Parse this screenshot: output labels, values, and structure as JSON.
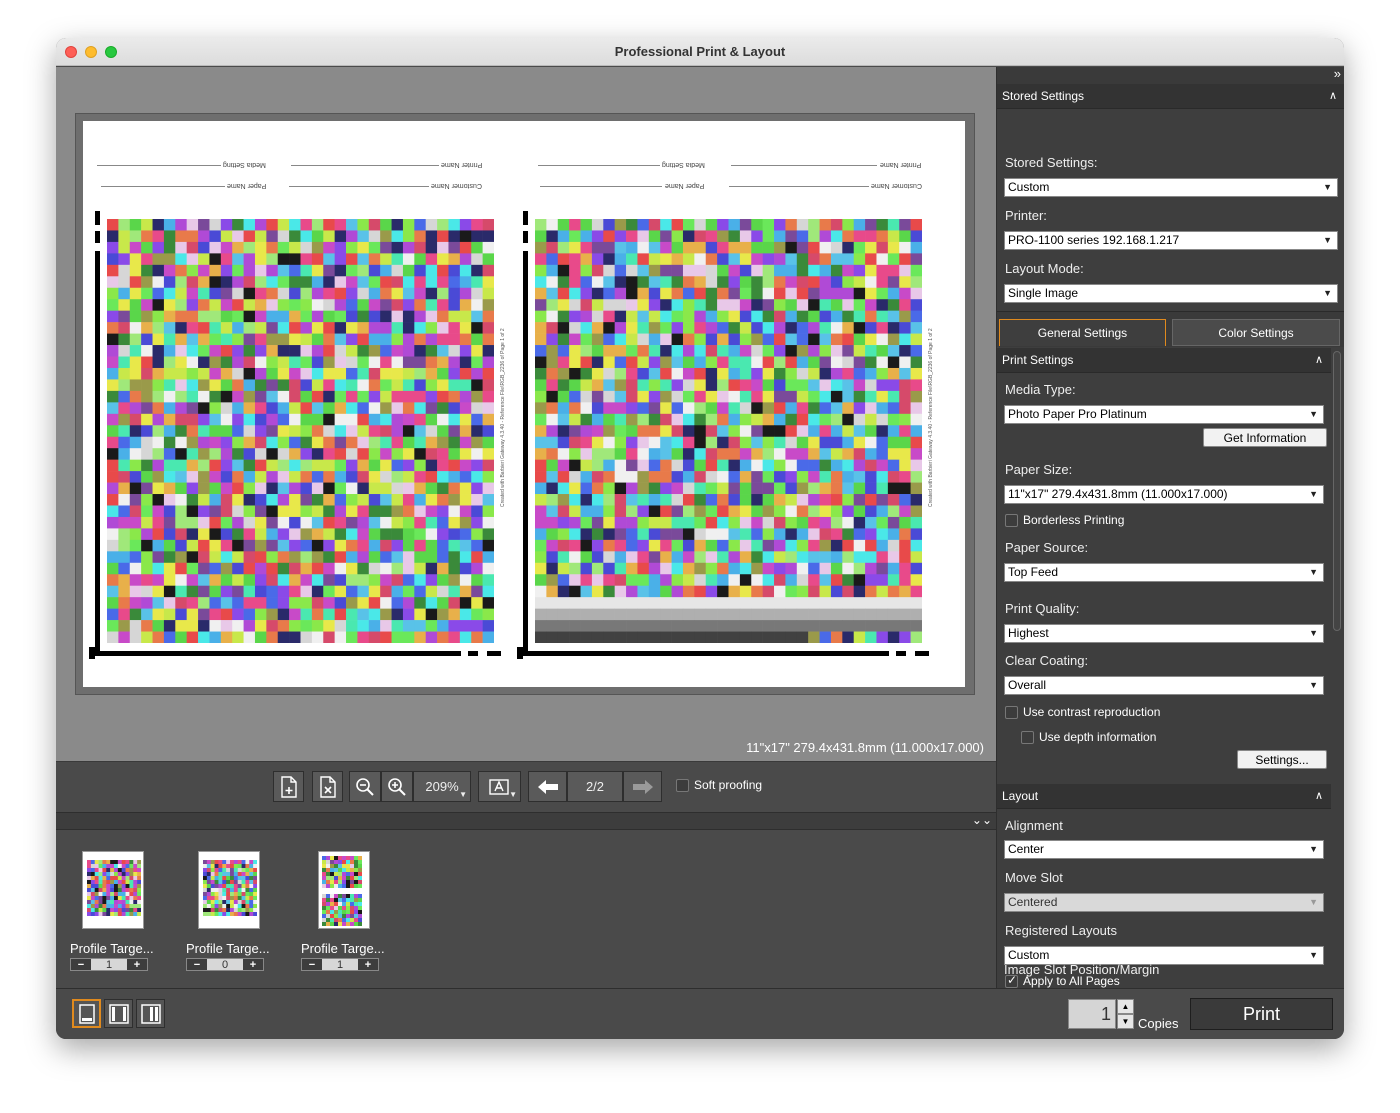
{
  "window": {
    "title": "Professional Print & Layout",
    "traffic_lights": {
      "close": "#fe5f57",
      "minimize": "#febc2e",
      "zoom": "#28c840"
    }
  },
  "preview": {
    "sheet_labels": [
      "Media Setting",
      "Printer Name",
      "Paper Name",
      "Customer Name"
    ],
    "side_caption_1": "Created with Barbieri Gateway 4.3.40 - Reference File\\RGB_2236 of Page 1 of 2",
    "side_caption_2": "Created with Barbieri Gateway 4.3.40 - Reference File\\RGB_2236 of Page 1 of 2",
    "paper_size_status": "11\"x17\" 279.4x431.8mm (11.000x17.000)"
  },
  "toolbar": {
    "zoom_value": "209%",
    "page_indicator": "2/2",
    "soft_proofing_label": "Soft proofing",
    "icons": {
      "add_page": "add-page-icon",
      "delete_page": "delete-page-icon",
      "zoom_out": "zoom-out-icon",
      "zoom_in": "zoom-in-icon",
      "text_tool": "text-tool-icon",
      "prev": "arrow-left-icon",
      "next": "arrow-right-icon"
    }
  },
  "thumbnails": [
    {
      "label": "Profile Targe...",
      "count": "1"
    },
    {
      "label": "Profile Targe...",
      "count": "0"
    },
    {
      "label": "Profile Targe...",
      "count": "1"
    }
  ],
  "bottom": {
    "copies_value": "1",
    "copies_label": "Copies",
    "print_label": "Print"
  },
  "panel": {
    "stored_settings_header": "Stored Settings",
    "stored_settings_label": "Stored Settings:",
    "stored_settings_value": "Custom",
    "printer_label": "Printer:",
    "printer_value": "PRO-1100 series 192.168.1.217",
    "layout_mode_label": "Layout Mode:",
    "layout_mode_value": "Single Image",
    "tabs": [
      "General Settings",
      "Color Settings"
    ],
    "print_settings_header": "Print Settings",
    "media_type_label": "Media Type:",
    "media_type_value": "Photo Paper Pro Platinum",
    "get_information_label": "Get Information",
    "paper_size_label": "Paper Size:",
    "paper_size_value": "11\"x17\" 279.4x431.8mm (11.000x17.000)",
    "borderless_label": "Borderless Printing",
    "paper_source_label": "Paper Source:",
    "paper_source_value": "Top Feed",
    "print_quality_label": "Print Quality:",
    "print_quality_value": "Highest",
    "clear_coating_label": "Clear Coating:",
    "clear_coating_value": "Overall",
    "contrast_label": "Use contrast reproduction",
    "depth_label": "Use depth information",
    "settings_button_label": "Settings...",
    "layout_header": "Layout",
    "alignment_label": "Alignment",
    "alignment_value": "Center",
    "move_slot_label": "Move Slot",
    "move_slot_value": "Centered",
    "registered_layouts_label": "Registered Layouts",
    "registered_layouts_value": "Custom",
    "apply_all_label": "Apply to All Pages",
    "apply_all_checked": true,
    "image_slot_label": "Image Slot Position/Margin"
  }
}
